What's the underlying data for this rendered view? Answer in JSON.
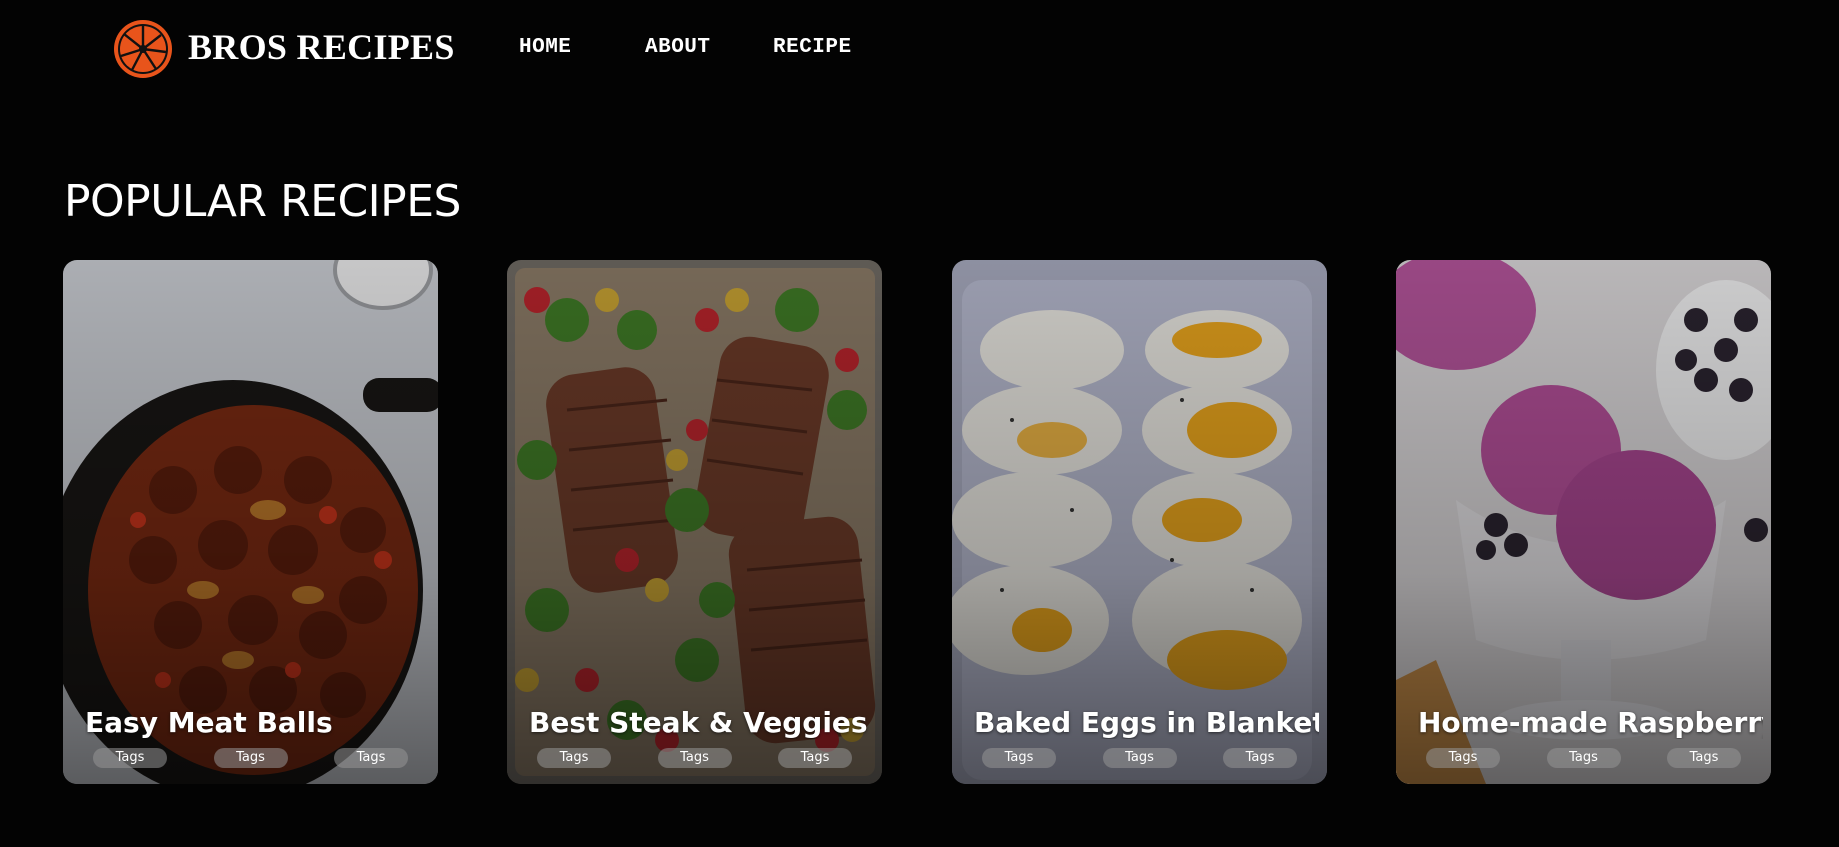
{
  "header": {
    "brand": "BROS RECIPES",
    "logo_icon": "orange-slice-icon",
    "nav": [
      "HOME",
      "ABOUT",
      "RECIPE"
    ]
  },
  "section": {
    "title": "POPULAR RECIPES"
  },
  "cards": [
    {
      "title": "Easy Meat Balls",
      "tags": [
        "Tags",
        "Tags",
        "Tags"
      ],
      "image": "meatballs-skillet"
    },
    {
      "title": "Best Steak & Veggies",
      "tags": [
        "Tags",
        "Tags",
        "Tags"
      ],
      "image": "steak-sheet-pan"
    },
    {
      "title": "Baked Eggs in Blanket",
      "tags": [
        "Tags",
        "Tags",
        "Tags"
      ],
      "image": "baked-eggs"
    },
    {
      "title": "Home-made Raspberry",
      "tags": [
        "Tags",
        "Tags",
        "Tags"
      ],
      "image": "raspberry-ice-cream"
    }
  ],
  "colors": {
    "background": "#030303",
    "accent": "#e8541b",
    "text": "#ffffff"
  }
}
